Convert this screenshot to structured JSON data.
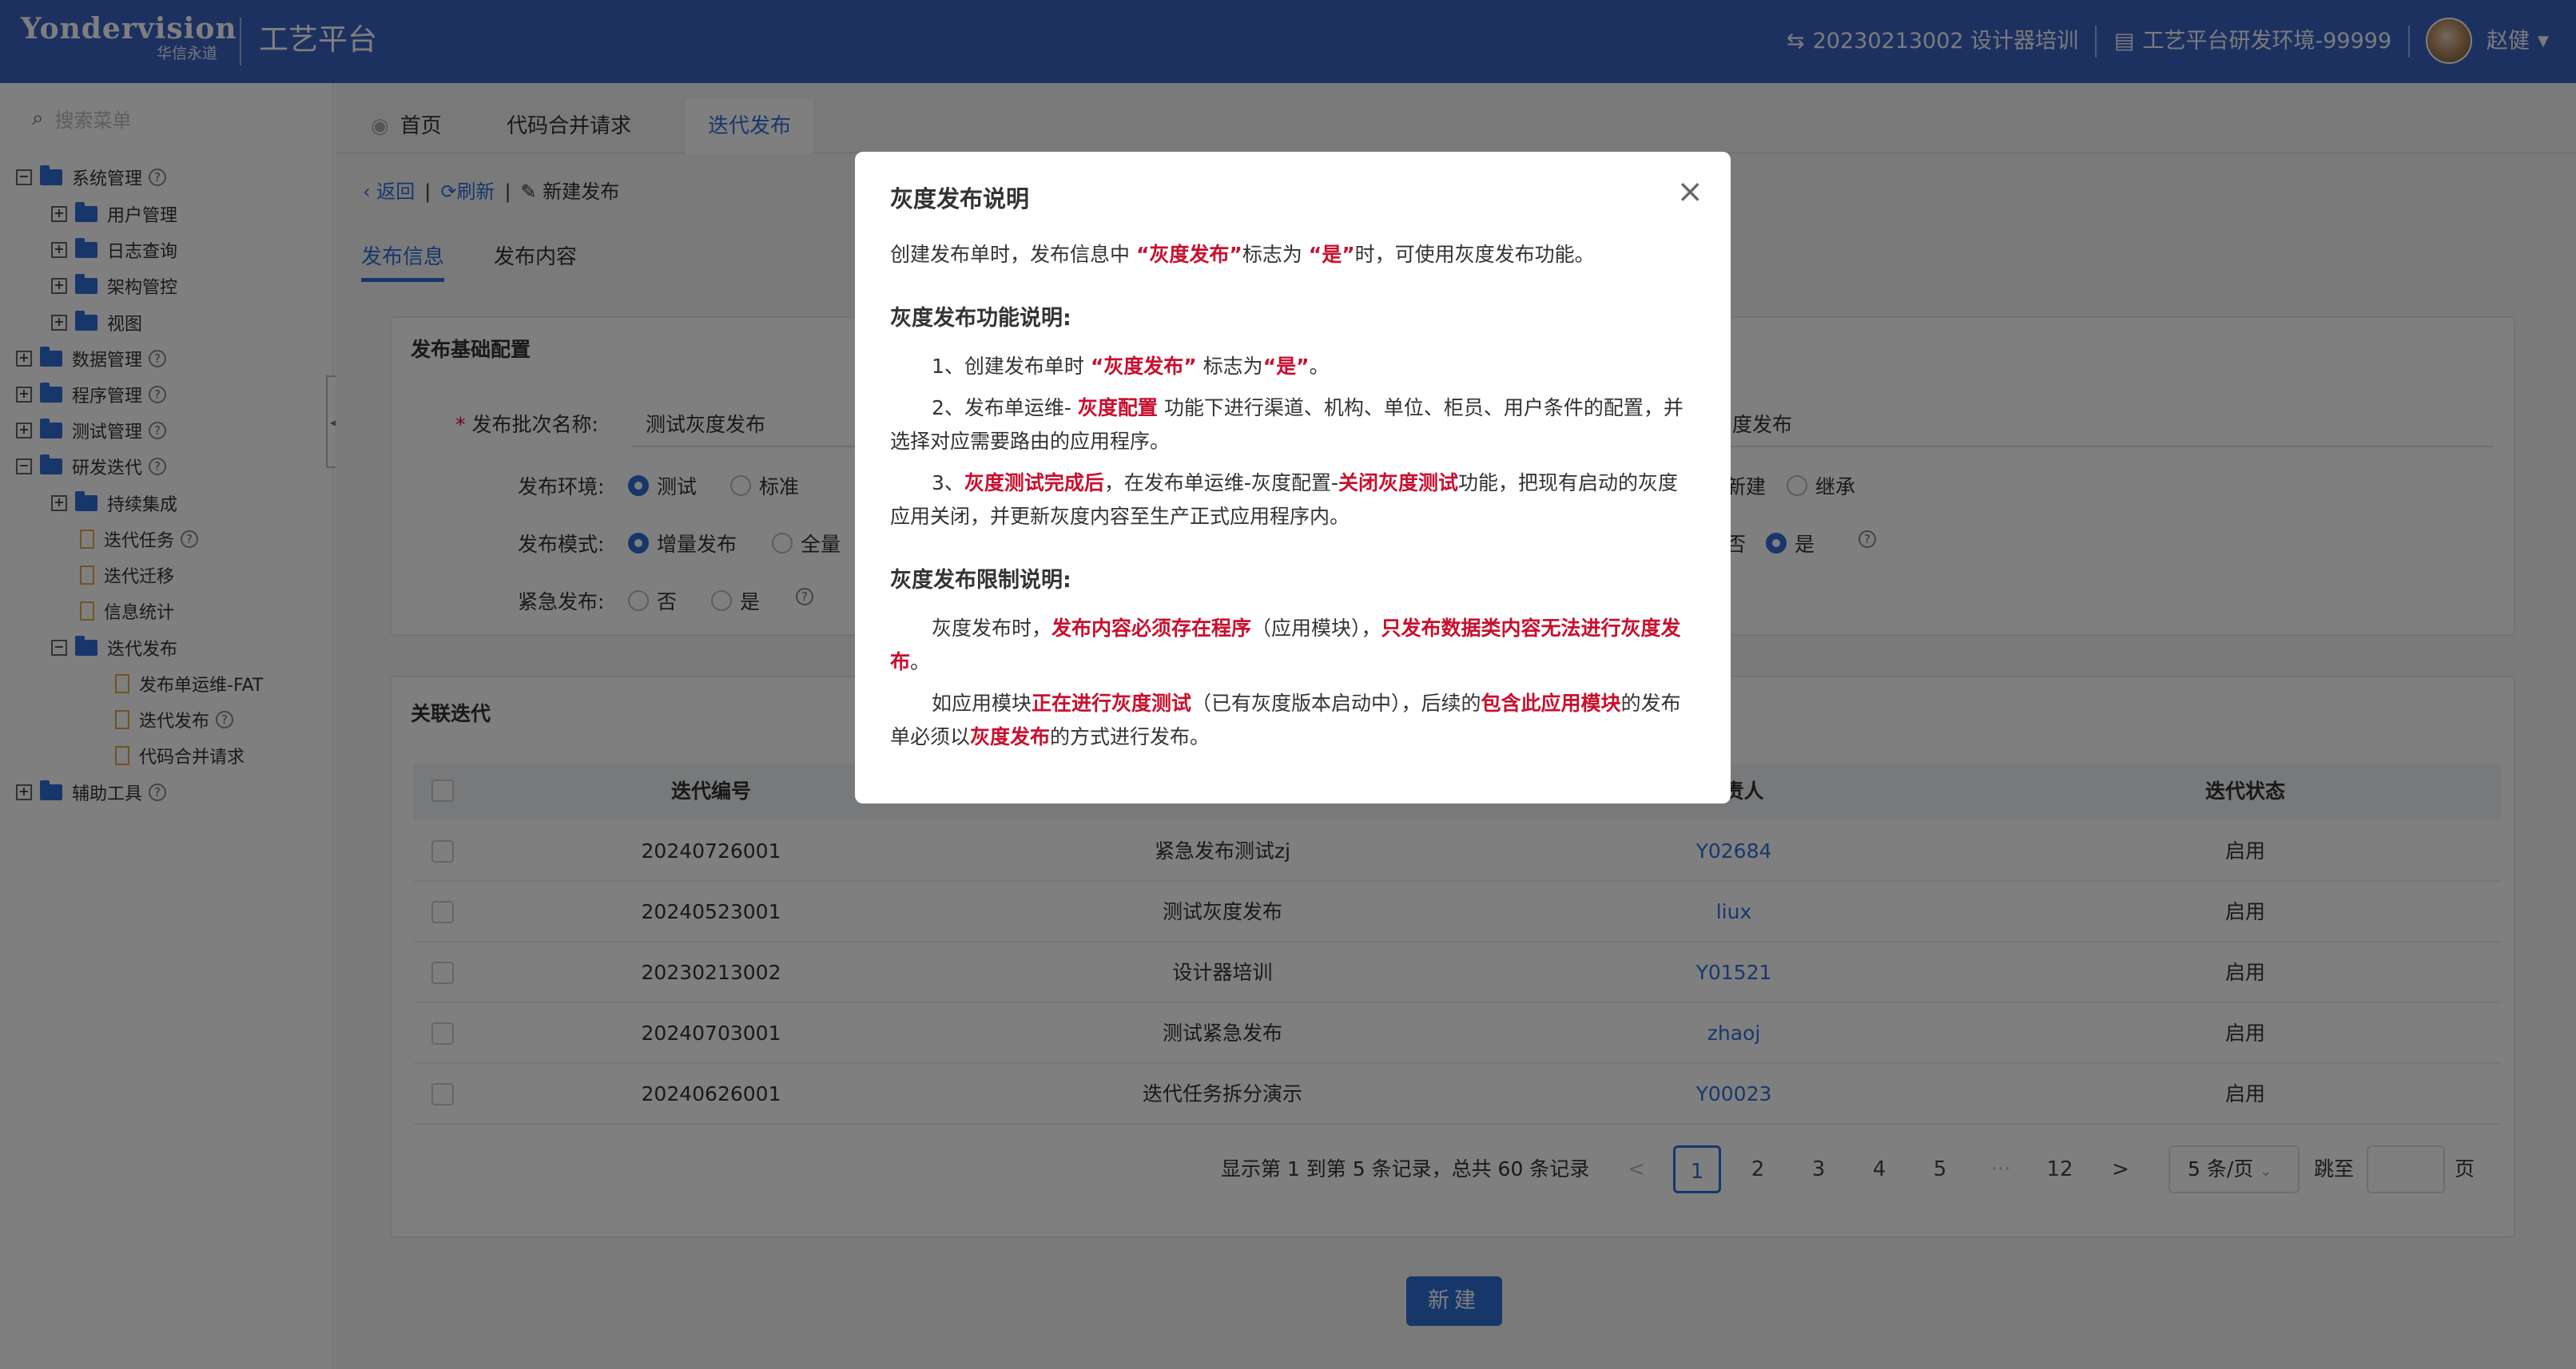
{
  "header": {
    "logo_text": "Yondervision",
    "logo_sub": "华信永道",
    "platform": "工艺平台",
    "iteration": "20230213002 设计器培训",
    "env": "工艺平台研发环境-99999",
    "user": "赵健",
    "bg_color": "#3a63c2"
  },
  "sidebar": {
    "search_placeholder": "搜索菜单",
    "items": [
      {
        "label": "系统管理",
        "help": "?"
      },
      {
        "label": "用户管理"
      },
      {
        "label": "日志查询"
      },
      {
        "label": "架构管控"
      },
      {
        "label": "视图"
      },
      {
        "label": "数据管理",
        "help": "?"
      },
      {
        "label": "程序管理",
        "help": "?"
      },
      {
        "label": "测试管理",
        "help": "?"
      },
      {
        "label": "研发迭代",
        "help": "?"
      },
      {
        "label": "持续集成"
      },
      {
        "label": "迭代任务",
        "help": "?"
      },
      {
        "label": "迭代迁移"
      },
      {
        "label": "信息统计"
      },
      {
        "label": "迭代发布"
      },
      {
        "label": "发布单运维-FAT"
      },
      {
        "label": "迭代发布",
        "help": "?"
      },
      {
        "label": "代码合并请求"
      },
      {
        "label": "辅助工具",
        "help": "?"
      }
    ]
  },
  "tabs": [
    "首页",
    "代码合并请求",
    "迭代发布"
  ],
  "breadcrumb": {
    "back": "返回",
    "refresh": "刷新",
    "current": "新建发布"
  },
  "subtabs": [
    "发布信息",
    "发布内容"
  ],
  "form": {
    "section_title": "发布基础配置",
    "batch_label": "发布批次名称:",
    "batch_value": "测试灰度发布",
    "batch_value_right": "度发布",
    "env_label": "发布环境:",
    "env_options": [
      "测试",
      "标准"
    ],
    "mode_label": "发布模式:",
    "mode_options": [
      "增量发布",
      "全量"
    ],
    "urgent_label": "紧急发布:",
    "urgent_options": [
      "否",
      "是"
    ],
    "right_opts_1": [
      "新建",
      "继承"
    ],
    "right_opts_2": [
      "否",
      "是"
    ]
  },
  "related": {
    "title": "关联迭代",
    "columns": [
      "迭代编号",
      "负责人",
      "迭代状态"
    ],
    "rows": [
      {
        "id": "20240726001",
        "name": "紧急发布测试zj",
        "owner": "Y02684",
        "status": "启用"
      },
      {
        "id": "20240523001",
        "name": "测试灰度发布",
        "owner": "liux",
        "status": "启用"
      },
      {
        "id": "20230213002",
        "name": "设计器培训",
        "owner": "Y01521",
        "status": "启用"
      },
      {
        "id": "20240703001",
        "name": "测试紧急发布",
        "owner": "zhaoj",
        "status": "启用"
      },
      {
        "id": "20240626001",
        "name": "迭代任务拆分演示",
        "owner": "Y00023",
        "status": "启用"
      }
    ]
  },
  "pagination": {
    "summary": "显示第 1 到第 5 条记录，总共 60 条记录",
    "pages": [
      "1",
      "2",
      "3",
      "4",
      "5",
      "···",
      "12"
    ],
    "active": "1",
    "prev": "<",
    "next": ">",
    "page_size": "5 条/页",
    "jump_label": "跳至",
    "page_suffix": "页"
  },
  "new_button": "新建",
  "modal": {
    "title": "灰度发布说明",
    "close": "×",
    "intro": [
      "创建发布单时，发布信息中 ",
      "“灰度发布”",
      "标志为 ",
      "“是”",
      "时，可使用灰度发布功能。"
    ],
    "func_title": "灰度发布功能说明:",
    "func_1": [
      "1、创建发布单时 ",
      "“灰度发布”",
      " 标志为",
      "“是”",
      "。"
    ],
    "func_2": [
      "2、发布单运维- ",
      "灰度配置",
      " 功能下进行渠道、机构、单位、柜员、用户条件的配置，并选择对应需要路由的应用程序。"
    ],
    "func_3": [
      "3、",
      "灰度测试完成后",
      "，在发布单运维-灰度配置-",
      "关闭灰度测试",
      "功能，把现有启动的灰度应用关闭，并更新灰度内容至生产正式应用程序内。"
    ],
    "limit_title": "灰度发布限制说明:",
    "limit_1": [
      "灰度发布时，",
      "发布内容必须存在程序",
      "（应用模块），",
      "只发布数据类内容无法进行灰度发布",
      "。"
    ],
    "limit_2": [
      "如应用模块",
      "正在进行灰度测试",
      "（已有灰度版本启动中），后续的",
      "包含此应用模块",
      "的发布单必须以",
      "灰度发布",
      "的方式进行发布。"
    ]
  }
}
